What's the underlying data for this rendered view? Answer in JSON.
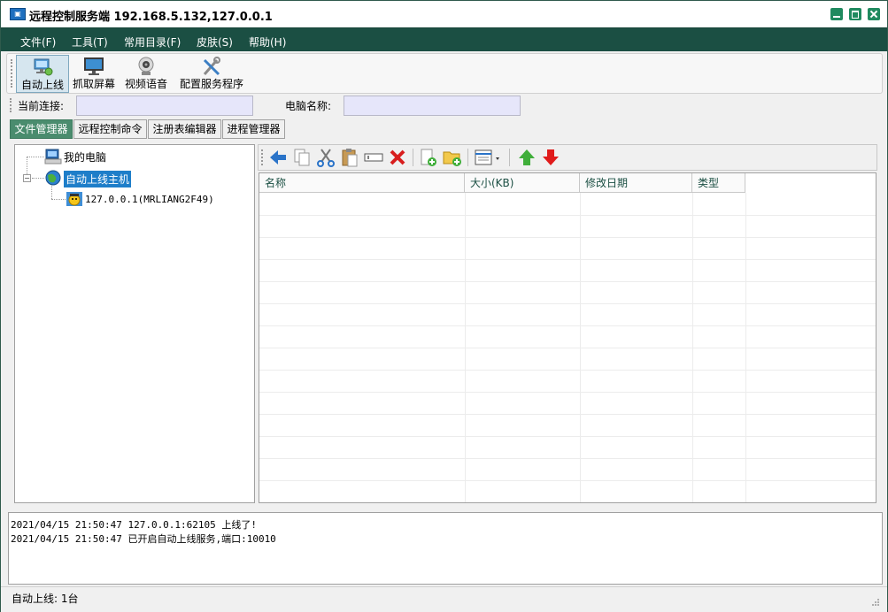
{
  "window": {
    "title": "远程控制服务端  192.168.5.132,127.0.0.1",
    "accent": "#1b4f43"
  },
  "menu": [
    {
      "label": "文件(F)"
    },
    {
      "label": "工具(T)"
    },
    {
      "label": "常用目录(F)"
    },
    {
      "label": "皮肤(S)"
    },
    {
      "label": "帮助(H)"
    }
  ],
  "toolbar": {
    "buttons": [
      {
        "label": "自动上线",
        "icon": "online-computer-icon",
        "active": true
      },
      {
        "label": "抓取屏幕",
        "icon": "monitor-icon",
        "active": false
      },
      {
        "label": "视频语音",
        "icon": "webcam-icon",
        "active": false
      },
      {
        "label": "配置服务程序",
        "icon": "tools-icon",
        "active": false
      }
    ]
  },
  "connection": {
    "current_label": "当前连接:",
    "current_value": "",
    "computer_name_label": "电脑名称:",
    "computer_name_value": ""
  },
  "tabs": [
    {
      "label": "文件管理器",
      "active": true
    },
    {
      "label": "远程控制命令",
      "active": false
    },
    {
      "label": "注册表编辑器",
      "active": false
    },
    {
      "label": "进程管理器",
      "active": false
    }
  ],
  "tree": {
    "root": {
      "label": "我的电脑",
      "icon": "my-computer-icon"
    },
    "group": {
      "label": "自动上线主机",
      "icon": "globe-icon",
      "expanded": true,
      "selected": true
    },
    "host": {
      "label": "127.0.0.1(MRLIANG2F49)",
      "icon": "host-avatar-icon"
    }
  },
  "file_toolbar": {
    "buttons": [
      {
        "icon": "back-arrow-icon"
      },
      {
        "icon": "copy-icon"
      },
      {
        "icon": "cut-icon"
      },
      {
        "icon": "paste-icon"
      },
      {
        "icon": "rename-icon"
      },
      {
        "icon": "delete-icon"
      },
      {
        "icon": "new-file-icon"
      },
      {
        "icon": "new-folder-icon"
      },
      {
        "icon": "view-mode-icon"
      },
      {
        "icon": "upload-icon"
      },
      {
        "icon": "download-icon"
      }
    ]
  },
  "filelist": {
    "columns": [
      "名称",
      "大小(KB)",
      "修改日期",
      "类型"
    ],
    "rows": []
  },
  "log": {
    "lines": [
      "2021/04/15 21:50:47 127.0.0.1:62105 上线了!",
      "2021/04/15 21:50:47 已开启自动上线服务,端口:10010"
    ]
  },
  "status": {
    "text": "自动上线: 1台"
  }
}
